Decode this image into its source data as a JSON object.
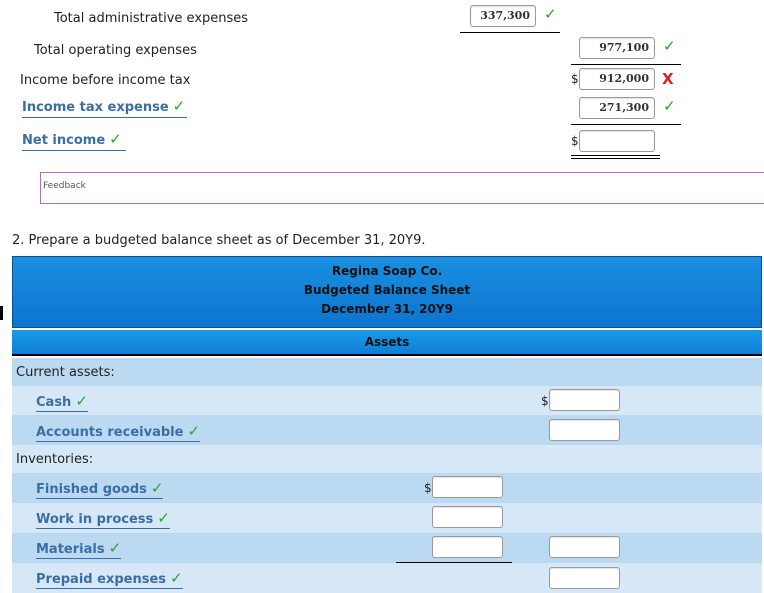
{
  "income": {
    "total_admin": {
      "label": "Total administrative expenses",
      "value": "337,300"
    },
    "total_operating": {
      "label": "Total operating expenses",
      "value": "977,100"
    },
    "income_before_tax": {
      "label": "Income before income tax",
      "value": "912,000",
      "currency": "$"
    },
    "income_tax": {
      "label": "Income tax expense",
      "value": "271,300"
    },
    "net_income": {
      "label": "Net income",
      "value": "",
      "currency": "$"
    }
  },
  "feedback": {
    "label": "Feedback"
  },
  "question": {
    "text": "2. Prepare a budgeted balance sheet as of December 31, 20Y9."
  },
  "sheet": {
    "company": "Regina Soap Co.",
    "title": "Budgeted Balance Sheet",
    "date": "December 31, 20Y9",
    "section": "Assets",
    "current_assets": "Current assets:",
    "cash": "Cash",
    "accounts_receivable": "Accounts receivable",
    "inventories": "Inventories:",
    "finished_goods": "Finished goods",
    "work_in_process": "Work in process",
    "materials": "Materials",
    "prepaid_expenses": "Prepaid expenses",
    "currency": "$"
  },
  "marks": {
    "check": "✓",
    "cross": "X"
  },
  "colors": {
    "check": "#2aa52a",
    "cross": "#e02020",
    "account": "#3a6ea5",
    "header": "#0d74cf"
  }
}
